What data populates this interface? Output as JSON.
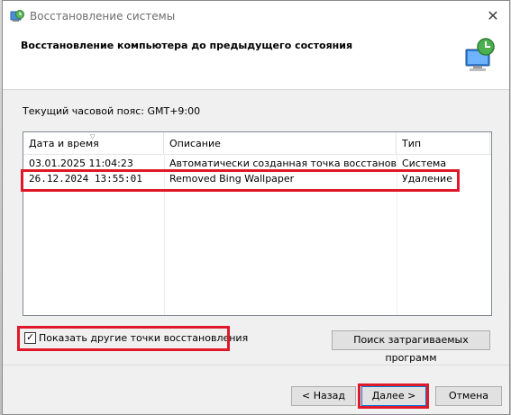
{
  "window": {
    "title": "Восстановление системы",
    "header_title": "Восстановление компьютера до предыдущего состояния"
  },
  "timezone_label": "Текущий часовой пояс: GMT+9:00",
  "list": {
    "columns": [
      "Дата и время",
      "Описание",
      "Тип"
    ],
    "rows": [
      {
        "date": "03.01.2025 11:04:23",
        "description": "Автоматически созданная точка восстановле...",
        "type": "Система"
      },
      {
        "date": "26.12.2024 13:55:01",
        "description": "Removed Bing Wallpaper",
        "type": "Удаление"
      }
    ]
  },
  "show_more": {
    "label": "Показать другие точки восстановления",
    "checked": true
  },
  "buttons": {
    "scan": "Поиск затрагиваемых программ",
    "back": "< Назад",
    "next": "Далее >",
    "cancel": "Отмена"
  },
  "colors": {
    "highlight": "#e0192a",
    "accent": "#0078d7"
  },
  "icons": {
    "app": "system-restore-icon",
    "header": "restore-computer-icon",
    "close": "close-icon"
  }
}
